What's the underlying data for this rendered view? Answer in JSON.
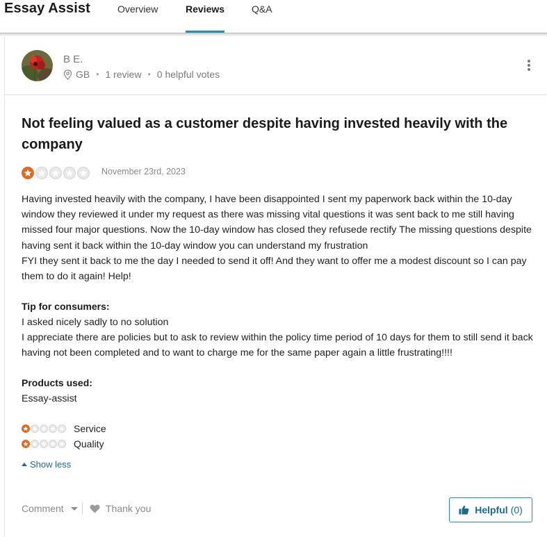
{
  "header": {
    "brand": "Essay Assist",
    "tabs": [
      {
        "label": "Overview",
        "active": false
      },
      {
        "label": "Reviews",
        "active": true
      },
      {
        "label": "Q&A",
        "active": false
      }
    ],
    "accent_color": "#1f8fb5"
  },
  "reviewer": {
    "name": "B E.",
    "location": "GB",
    "review_count": "1 review",
    "helpful_votes": "0 helpful votes",
    "location_icon": "map-pin-icon",
    "menu_icon": "kebab-menu-icon"
  },
  "review": {
    "title": "Not feeling valued as a customer despite having invested heavily with the company",
    "rating": 1,
    "rating_max": 5,
    "star_color": "#e06a1d",
    "date": "November 23rd, 2023",
    "body": [
      "Having invested heavily with the company, I have been disappointed I sent my paperwork back within the 10-day window they reviewed it under my request as there was missing vital questions it was sent back to me still having missed four major questions. Now the 10-day window has closed they refusede rectify The missing questions despite having sent it back within the 10-day window you can understand my frustration",
      "FYI they sent it back to me the day I needed to send it off! And they want to offer me a modest discount so I can pay them to do it again! Help!"
    ],
    "tip_label": "Tip for consumers:",
    "tip": [
      "I asked nicely sadly to no solution",
      "I appreciate there are policies but to ask to review within the policy time period of 10 days for them to still send it back having not been completed and to want to charge me for the same paper again a little frustrating!!!!"
    ],
    "products_label": "Products used:",
    "products": "Essay-assist",
    "sub_ratings": [
      {
        "label": "Service",
        "rating": 1
      },
      {
        "label": "Quality",
        "rating": 1
      }
    ],
    "show_less": "Show less"
  },
  "footer": {
    "comment": "Comment",
    "thank_you": "Thank you",
    "helpful": "Helpful",
    "helpful_count": "(0)"
  }
}
